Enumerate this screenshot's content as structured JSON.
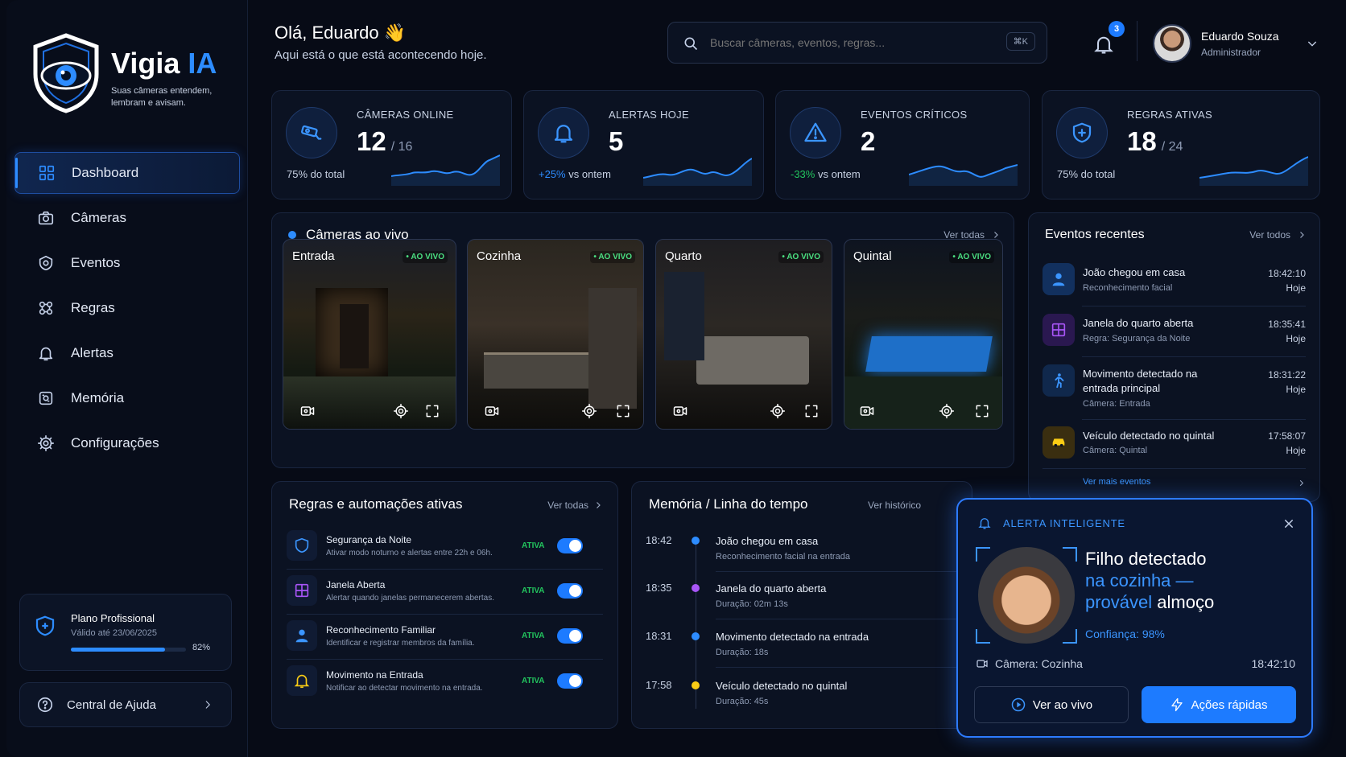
{
  "brand": {
    "name_main": "Vigia",
    "name_accent": "IA",
    "tagline_1": "Suas câmeras entendem,",
    "tagline_2": "lembram e avisam."
  },
  "nav": [
    {
      "label": "Dashboard"
    },
    {
      "label": "Câmeras"
    },
    {
      "label": "Eventos"
    },
    {
      "label": "Regras"
    },
    {
      "label": "Alertas"
    },
    {
      "label": "Memória"
    },
    {
      "label": "Configurações"
    }
  ],
  "plan": {
    "name": "Plano Profissional",
    "valid": "Válido até 23/06/2025",
    "usage_pct": "82%",
    "usage": 0.82
  },
  "help": {
    "label": "Central de Ajuda"
  },
  "header": {
    "greeting": "Olá, Eduardo 👋",
    "subtitle": "Aqui está o que está acontecendo hoje."
  },
  "search": {
    "placeholder": "Buscar câmeras, eventos, regras...",
    "shortcut": "⌘K"
  },
  "notifications": {
    "count": "3"
  },
  "user": {
    "name": "Eduardo Souza",
    "role": "Administrador"
  },
  "stats": [
    {
      "label": "CÂMERAS ONLINE",
      "value": "12",
      "of": "/ 16",
      "sub_a": "",
      "sub_b": "75% do total"
    },
    {
      "label": "ALERTAS HOJE",
      "value": "5",
      "of": "",
      "sub_a": "+25%",
      "sub_b": " vs ontem"
    },
    {
      "label": "EVENTOS CRÍTICOS",
      "value": "2",
      "of": "",
      "sub_a": "-33%",
      "sub_b": " vs ontem"
    },
    {
      "label": "REGRAS ATIVAS",
      "value": "18",
      "of": "/ 24",
      "sub_a": "",
      "sub_b": "75% do total"
    }
  ],
  "live": {
    "title": "Câmeras ao vivo",
    "see_all": "Ver todas",
    "live_badge": "• AO VIVO",
    "cameras": [
      {
        "name": "Entrada"
      },
      {
        "name": "Cozinha"
      },
      {
        "name": "Quarto"
      },
      {
        "name": "Quintal"
      }
    ]
  },
  "events": {
    "title": "Eventos recentes",
    "see_all": "Ver todos",
    "more": "Ver mais eventos",
    "items": [
      {
        "title": "João chegou em casa",
        "sub": "Reconhecimento facial",
        "time": "18:42:10",
        "day": "Hoje"
      },
      {
        "title": "Janela do quarto aberta",
        "sub": "Regra: Segurança da Noite",
        "time": "18:35:41",
        "day": "Hoje"
      },
      {
        "title": "Movimento detectado na entrada principal",
        "sub": "Câmera: Entrada",
        "time": "18:31:22",
        "day": "Hoje"
      },
      {
        "title": "Veículo detectado no quintal",
        "sub": "Câmera: Quintal",
        "time": "17:58:07",
        "day": "Hoje"
      }
    ]
  },
  "rules": {
    "title": "Regras e automações ativas",
    "see_all": "Ver todas",
    "status": "ATIVA",
    "items": [
      {
        "title": "Segurança da Noite",
        "sub": "Ativar modo noturno e alertas entre 22h e 06h."
      },
      {
        "title": "Janela Aberta",
        "sub": "Alertar quando janelas permanecerem abertas."
      },
      {
        "title": "Reconhecimento Familiar",
        "sub": "Identificar e registrar membros da família."
      },
      {
        "title": "Movimento na Entrada",
        "sub": "Notificar ao detectar movimento na entrada."
      }
    ]
  },
  "timeline": {
    "title": "Memória / Linha do tempo",
    "see_all": "Ver histórico",
    "items": [
      {
        "time": "18:42",
        "title": "João chegou em casa",
        "sub": "Reconhecimento facial na entrada",
        "color": "#2d8cff"
      },
      {
        "time": "18:35",
        "title": "Janela do quarto aberta",
        "sub": "Duração: 02m 13s",
        "color": "#a855f7"
      },
      {
        "time": "18:31",
        "title": "Movimento detectado na entrada",
        "sub": "Duração: 18s",
        "color": "#2d8cff"
      },
      {
        "time": "17:58",
        "title": "Veículo detectado no quintal",
        "sub": "Duração: 45s",
        "color": "#facc15"
      }
    ]
  },
  "alert": {
    "label": "ALERTA INTELIGENTE",
    "line1": "Filho detectado",
    "line2": "na cozinha —",
    "line3a": "provável",
    "line3b": " almoço",
    "confidence": "Confiança: 98%",
    "camera": "Câmera: Cozinha",
    "time": "18:42:10",
    "btn_live": "Ver ao vivo",
    "btn_actions": "Ações rápidas"
  },
  "colors": {
    "accent": "#2d8cff",
    "success": "#22c55e",
    "warning": "#facc15",
    "purple": "#a855f7",
    "bg": "#070b16"
  }
}
